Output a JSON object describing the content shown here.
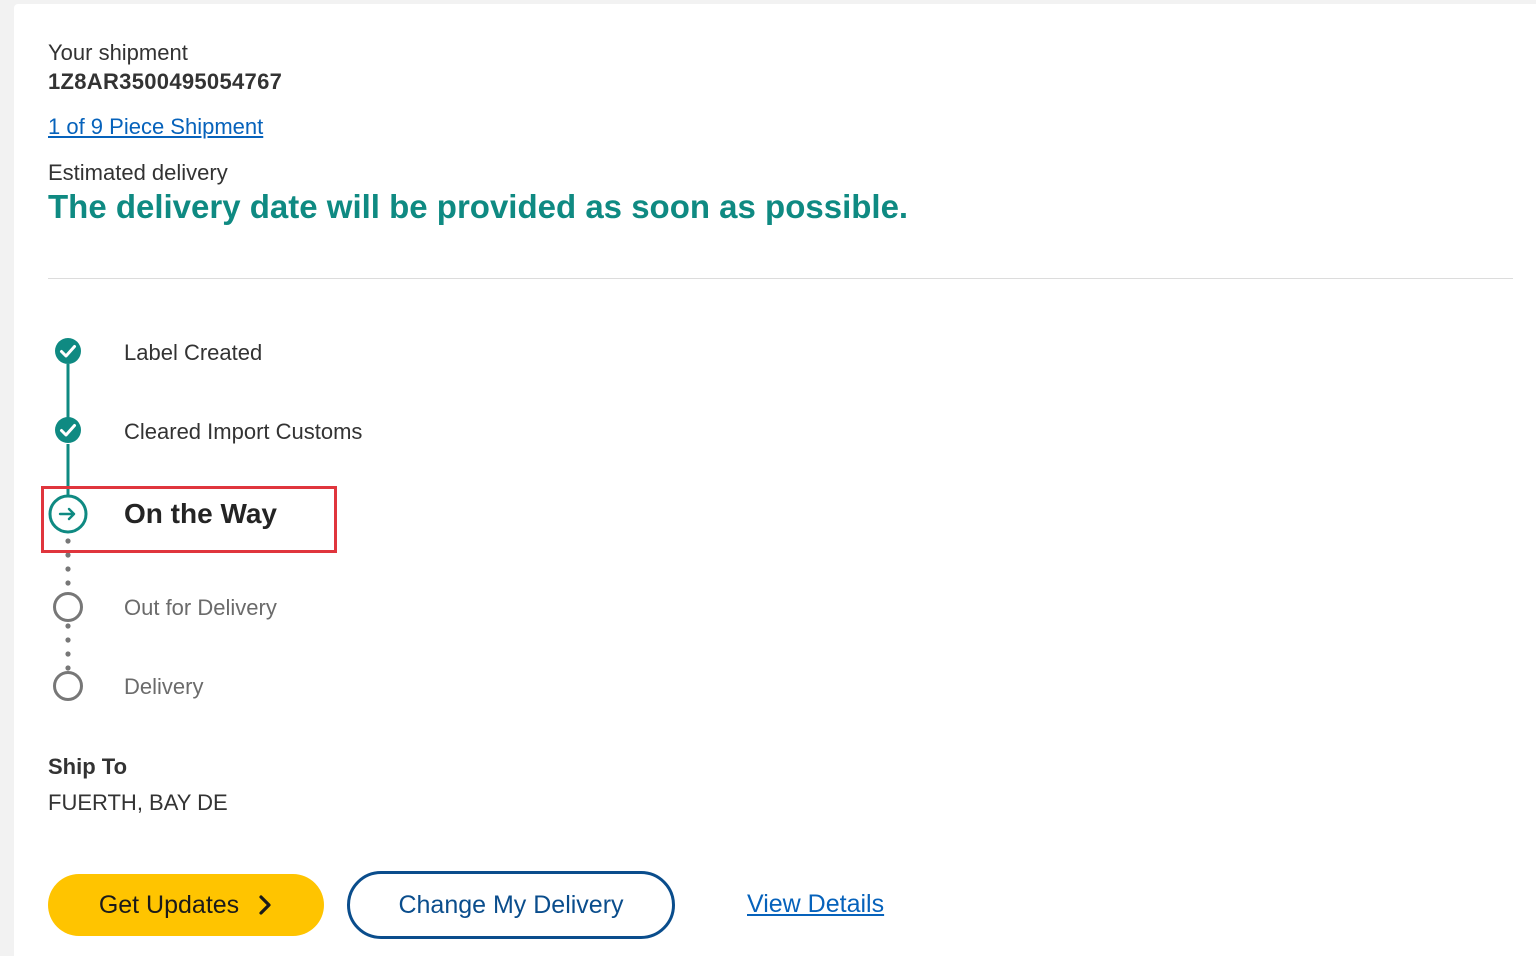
{
  "shipment": {
    "label": "Your shipment",
    "tracking_number": "1Z8AR3500495054767",
    "piece_link": "1 of 9 Piece Shipment"
  },
  "delivery": {
    "estimated_label": "Estimated delivery",
    "message": "The delivery date will be provided as soon as possible."
  },
  "timeline": {
    "steps": [
      {
        "label": "Label Created",
        "status": "complete"
      },
      {
        "label": "Cleared Import Customs",
        "status": "complete"
      },
      {
        "label": "On the Way",
        "status": "current"
      },
      {
        "label": "Out for Delivery",
        "status": "pending"
      },
      {
        "label": "Delivery",
        "status": "pending"
      }
    ]
  },
  "ship_to": {
    "label": "Ship To",
    "value": "FUERTH, BAY DE"
  },
  "actions": {
    "get_updates": "Get Updates",
    "change_delivery": "Change My Delivery",
    "view_details": "View Details"
  },
  "colors": {
    "teal": "#0f8a82",
    "link": "#0662bb",
    "yellow": "#ffc400",
    "navy": "#0a4d8c",
    "highlight": "#e0353d"
  }
}
